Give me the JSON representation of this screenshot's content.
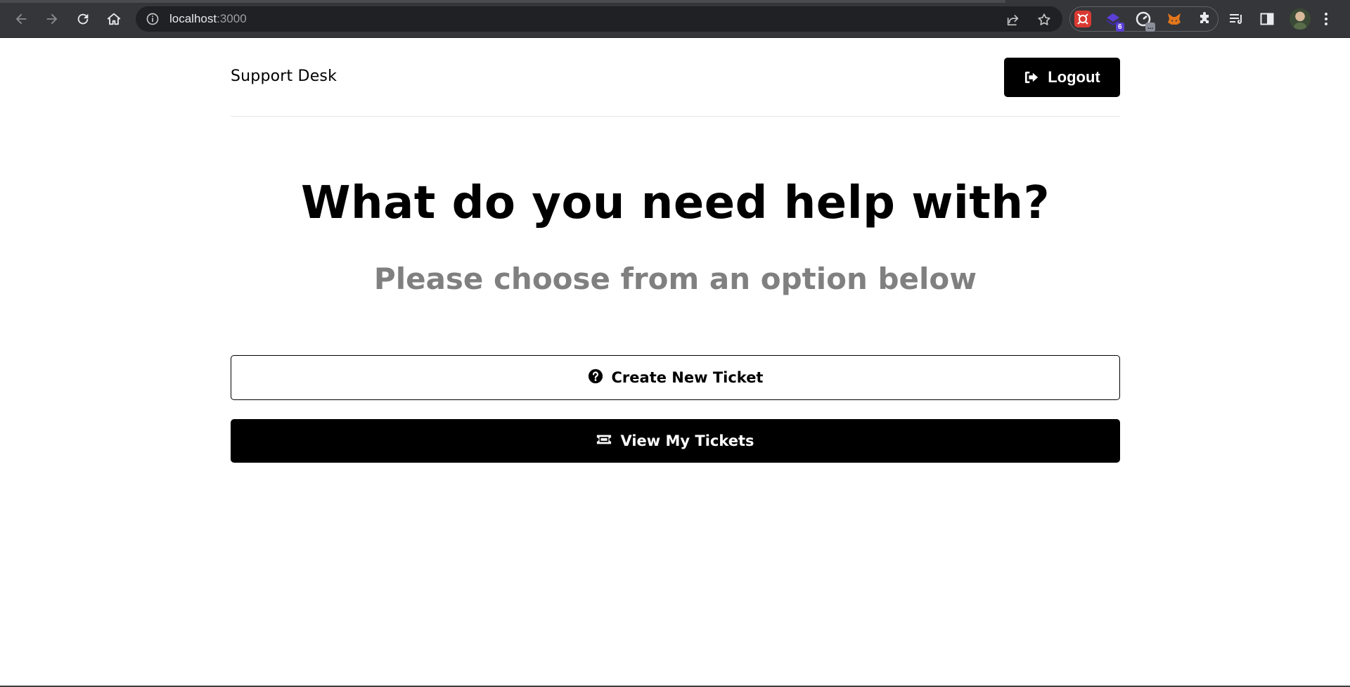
{
  "browser": {
    "url_host": "localhost",
    "url_port": ":3000",
    "extension_badge_count": "6",
    "extension_badge_dots": "..."
  },
  "header": {
    "logo": "Support Desk",
    "logout_label": "Logout"
  },
  "main": {
    "heading": "What do you need help with?",
    "subheading": "Please choose from an option below",
    "create_ticket_label": "Create New Ticket",
    "view_tickets_label": "View My Tickets"
  },
  "colors": {
    "primary": "#000000",
    "muted_text": "#808080",
    "chrome_bg": "#35363a",
    "omnibox_bg": "#202124"
  }
}
